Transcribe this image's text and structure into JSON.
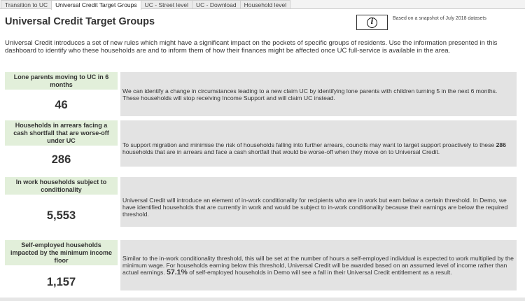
{
  "tabs": [
    {
      "label": "Transition to UC"
    },
    {
      "label": "Universal Credit Target Groups"
    },
    {
      "label": "UC - Street level"
    },
    {
      "label": "UC - Download"
    },
    {
      "label": "Household level"
    }
  ],
  "active_tab_index": 1,
  "header": {
    "title": "Universal Credit Target Groups",
    "snapshot_note": "Based on a snapshot of July 2018 datasets",
    "info_icon": "info-circle-icon"
  },
  "intro": "Universal Credit introduces a set of new rules which might have a significant impact on the pockets of specific groups of residents. Use the information presented in this dashboard to identify who these households are and to inform them of how their finances might be affected once UC full-service is available in the area.",
  "cards": [
    {
      "label": "Lone parents moving to UC in 6 months",
      "value": "46",
      "desc_before": "We can identify a change in circumstances leading to a new claim UC by identifying lone parents with children turning 5 in the next 6 months. These households will stop receiving Income Support and will claim UC instead.",
      "desc_em": "",
      "desc_after": ""
    },
    {
      "label": "Households in arrears facing a cash shortfall that are worse-off under UC",
      "value": "286",
      "desc_before": "To support migration and minimise the risk of households falling into further arrears, councils may want to target support proactively to these",
      "desc_em": "286",
      "desc_after": "households that are in arrears and face a cash shortfall that would be worse-off when they move on to Universal Credit."
    },
    {
      "label": "In work households subject to conditionality",
      "value": "5,553",
      "desc_before": "Universal Credit will introduce an element of in-work conditionality for recipients who are in work but earn below a certain threshold. In Demo, we have identified households that are currently in work and would be subject to in-work conditionality because their earnings are below the required threshold.",
      "desc_em": "",
      "desc_after": ""
    },
    {
      "label": "Self-employed households impacted by the minimum income floor",
      "value": "1,157",
      "desc_before": "Similar to the in-work conditionality threshold, this will be set at the number of hours a self-employed individual is expected to work multiplied by the minimum wage. For households earning below this threshold, Universal Credit will be awarded based on an assumed level of income rather than actual earnings.",
      "desc_em": "57.1%",
      "desc_after": "of self-employed households in Demo will see a fall in their Universal Credit entitlement as a result."
    }
  ],
  "colors": {
    "label_bg": "#e2efda",
    "desc_bg": "#e3e3e3",
    "text": "#333333"
  }
}
